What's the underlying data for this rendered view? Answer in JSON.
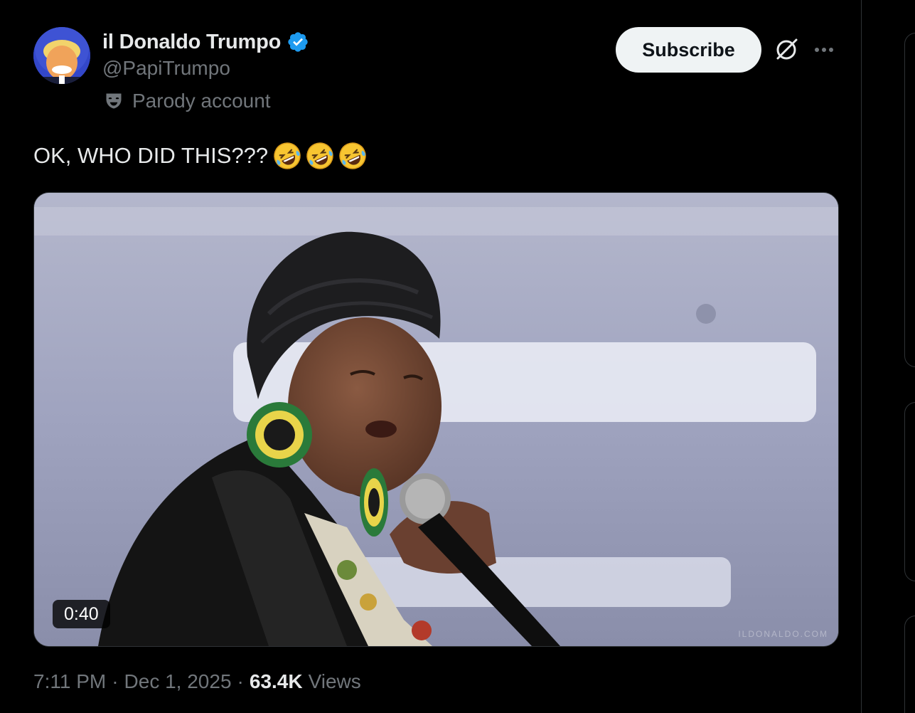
{
  "author": {
    "display_name": "il Donaldo Trumpo",
    "handle": "@PapiTrumpo",
    "label": "Parody account",
    "verified": true,
    "verified_color": "#1d9bf0"
  },
  "actions": {
    "subscribe_label": "Subscribe",
    "grok_icon": "grok-icon",
    "more_icon": "more-icon"
  },
  "tweet": {
    "text": "OK, WHO DID THIS???",
    "emojis": [
      "rolling-on-floor-laughing",
      "rolling-on-floor-laughing",
      "rolling-on-floor-laughing"
    ]
  },
  "media": {
    "type": "video",
    "duration": "0:40",
    "watermark": "ILDONALDO.COM"
  },
  "meta": {
    "time": "7:11 PM",
    "sep1": "·",
    "date": "Dec 1, 2025",
    "sep2": "·",
    "views_count": "63.4K",
    "views_label": "Views"
  },
  "colors": {
    "background": "#000000",
    "text_primary": "#e7e9ea",
    "text_secondary": "#71767b",
    "border": "#2f3336",
    "button_bg": "#eff3f4"
  }
}
